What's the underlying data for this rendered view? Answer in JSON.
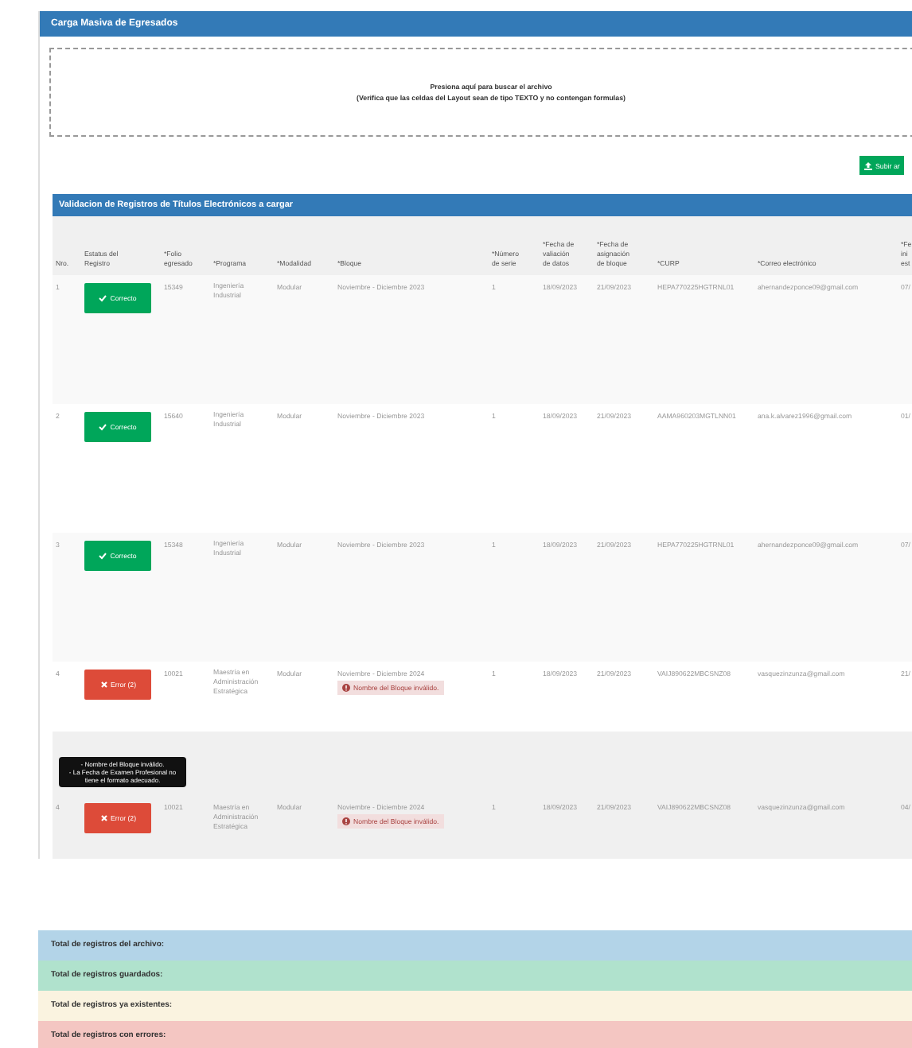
{
  "upload_panel": {
    "title": "Carga Masiva de Egresados",
    "dropzone": {
      "line1": "Presiona aquí para buscar el archivo",
      "line2": "(Verifica que las celdas del Layout sean de tipo TEXTO y no contengan formulas)"
    },
    "upload_button": "Subir ar"
  },
  "validation_panel": {
    "title": "Validacion de Registros de Títulos Electrónicos a cargar",
    "columns": [
      [
        "Nro."
      ],
      [
        "Estatus del",
        "Registro"
      ],
      [
        "*Folio",
        "egresado"
      ],
      [
        "*Programa"
      ],
      [
        "*Modalidad"
      ],
      [
        "*Bloque"
      ],
      [
        "*Número",
        "de serie"
      ],
      [
        "*Fecha de",
        "valiación",
        "de datos"
      ],
      [
        "*Fecha de",
        "asignación",
        "de bloque"
      ],
      [
        "*CURP"
      ],
      [
        "*Correo electrónico"
      ],
      [
        "*Fe",
        "ini",
        "est"
      ]
    ],
    "rows": [
      {
        "nro": "1",
        "status": {
          "kind": "ok",
          "label": "Correcto"
        },
        "folio": "15349",
        "programa": "Ingeniería Industrial",
        "modalidad": "Modular",
        "bloque": "Noviembre - Diciembre 2023",
        "serie": "1",
        "fecha_validacion": "18/09/2023",
        "fecha_asignacion": "21/09/2023",
        "curp": "HEPA770225HGTRNL01",
        "correo": "ahernandezponce09@gmail.com",
        "column_12": "07/",
        "hovered": false
      },
      {
        "nro": "2",
        "status": {
          "kind": "ok",
          "label": "Correcto"
        },
        "folio": "15640",
        "programa": "Ingeniería Industrial",
        "modalidad": "Modular",
        "bloque": "Noviembre - Diciembre 2023",
        "serie": "1",
        "fecha_validacion": "18/09/2023",
        "fecha_asignacion": "21/09/2023",
        "curp": "AAMA960203MGTLNN01",
        "correo": "ana.k.alvarez1996@gmail.com",
        "column_12": "01/",
        "hovered": false
      },
      {
        "nro": "3",
        "status": {
          "kind": "ok",
          "label": "Correcto"
        },
        "folio": "15348",
        "programa": "Ingeniería Industrial",
        "modalidad": "Modular",
        "bloque": "Noviembre - Diciembre 2023",
        "serie": "1",
        "fecha_validacion": "18/09/2023",
        "fecha_asignacion": "21/09/2023",
        "curp": "HEPA770225HGTRNL01",
        "correo": "ahernandezponce09@gmail.com",
        "column_12": "07/",
        "hovered": false
      },
      {
        "nro": "4",
        "status": {
          "kind": "error",
          "label": "Error (2)"
        },
        "folio": "10021",
        "programa": "Maestría en Administración Estratégica",
        "modalidad": "Modular",
        "bloque": "Noviembre - Diciembre 2024",
        "bloque_error": "Nombre del Bloque inválido.",
        "serie": "1",
        "fecha_validacion": "18/09/2023",
        "fecha_asignacion": "21/09/2023",
        "curp": "VAIJ890622MBCSNZ08",
        "correo": "vasquezinzunza@gmail.com",
        "column_12": "21/",
        "hovered": false
      },
      {
        "nro": "4",
        "status": {
          "kind": "error",
          "label": "Error (2)",
          "tooltip": [
            "- Nombre del Bloque inválido.",
            "- La Fecha de Examen Profesional no tiene el formato adecuado."
          ]
        },
        "folio": "10021",
        "programa": "Maestría en Administración Estratégica",
        "modalidad": "Modular",
        "bloque": "Noviembre - Diciembre 2024",
        "bloque_error": "Nombre del Bloque inválido.",
        "serie": "1",
        "fecha_validacion": "18/09/2023",
        "fecha_asignacion": "21/09/2023",
        "curp": "VAIJ890622MBCSNZ08",
        "correo": "vasquezinzunza@gmail.com",
        "column_12": "04/",
        "hovered": true
      }
    ]
  },
  "totals": [
    {
      "label": "Total de registros del archivo:",
      "color": "#b3d4e8"
    },
    {
      "label": "Total de registros guardados:",
      "color": "#b0e2cd"
    },
    {
      "label": "Total de registros ya existentes:",
      "color": "#faf3e0"
    },
    {
      "label": "Total de registros con errores:",
      "color": "#f4c6c2"
    }
  ]
}
